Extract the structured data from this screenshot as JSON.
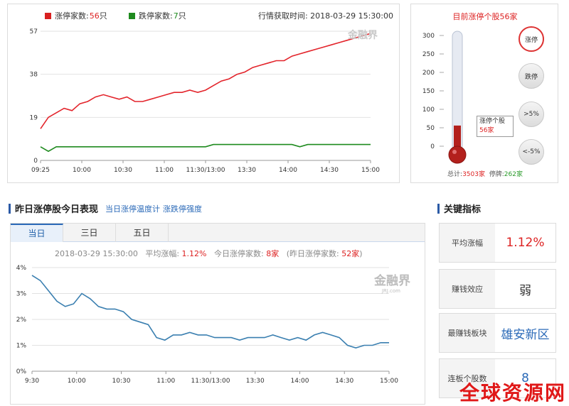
{
  "top": {
    "legend_up_label": "涨停家数:",
    "legend_up_value": "56",
    "legend_up_unit": "只",
    "legend_down_label": "跌停家数:",
    "legend_down_value": "7",
    "legend_down_unit": "只",
    "fetch_label": "行情获取时间:",
    "fetch_time": "2018-03-29 15:30:00",
    "watermark": "金融界",
    "chart_data": {
      "type": "line",
      "x_ticks": [
        "09:25",
        "10:00",
        "10:30",
        "11:00",
        "11:30/13:00",
        "13:30",
        "14:00",
        "14:30",
        "15:00"
      ],
      "y_ticks": [
        "57",
        "38",
        "19",
        "0"
      ],
      "ylim": [
        0,
        57
      ],
      "series": [
        {
          "name": "涨停家数",
          "color": "#e3242b",
          "values": [
            14,
            19,
            21,
            23,
            22,
            25,
            26,
            28,
            29,
            28,
            27,
            28,
            26,
            26,
            27,
            28,
            29,
            30,
            30,
            31,
            30,
            31,
            33,
            35,
            36,
            38,
            39,
            41,
            42,
            43,
            44,
            44,
            46,
            47,
            48,
            49,
            50,
            51,
            52,
            53,
            54,
            55,
            56
          ]
        },
        {
          "name": "跌停家数",
          "color": "#1e8a1e",
          "values": [
            6,
            4,
            6,
            6,
            6,
            6,
            6,
            6,
            6,
            6,
            6,
            6,
            6,
            6,
            6,
            6,
            6,
            6,
            6,
            6,
            6,
            6,
            7,
            7,
            7,
            7,
            7,
            7,
            7,
            7,
            7,
            7,
            7,
            6,
            7,
            7,
            7,
            7,
            7,
            7,
            7,
            7,
            7
          ]
        }
      ]
    }
  },
  "thermo": {
    "title": "目前涨停个股56家",
    "scale": [
      "300",
      "250",
      "200",
      "150",
      "100",
      "50",
      "0"
    ],
    "level_value": 56,
    "level_max": 300,
    "callout_label": "涨停个股",
    "callout_value": "56家",
    "buttons": [
      "涨停",
      "跌停",
      ">5%",
      "<-5%"
    ],
    "total_label": "总计:",
    "total_value": "3503家",
    "halt_label": "停牌:",
    "halt_value": "262家"
  },
  "section": {
    "title": "昨日涨停股今日表现",
    "link1": "当日涨停温度计",
    "link2": "涨跌停强度"
  },
  "bottom": {
    "tabs": [
      "当日",
      "三日",
      "五日"
    ],
    "info_time": "2018-03-29 15:30:00",
    "avg_label": "平均涨幅:",
    "avg_value": "1.12%",
    "today_label": "今日涨停家数:",
    "today_value": "8家",
    "yest_label": "(昨日涨停家数:",
    "yest_value": "52家",
    "yest_close": ")",
    "watermark": "金融界",
    "watermark_sub": "JRJ.com",
    "chart_data": {
      "type": "line",
      "x_ticks": [
        "9:30",
        "10:00",
        "10:30",
        "11:00",
        "11:30/13:00",
        "13:30",
        "14:00",
        "14:30",
        "15:00"
      ],
      "y_ticks": [
        "4%",
        "3%",
        "2%",
        "1%",
        "0%"
      ],
      "ylim": [
        0,
        4
      ],
      "series": [
        {
          "color": "#3a7fb0",
          "values": [
            3.7,
            3.5,
            3.1,
            2.7,
            2.5,
            2.6,
            3.0,
            2.8,
            2.5,
            2.4,
            2.4,
            2.3,
            2.0,
            1.9,
            1.8,
            1.3,
            1.2,
            1.4,
            1.4,
            1.5,
            1.4,
            1.4,
            1.3,
            1.3,
            1.3,
            1.2,
            1.3,
            1.3,
            1.3,
            1.4,
            1.3,
            1.2,
            1.3,
            1.2,
            1.4,
            1.5,
            1.4,
            1.3,
            1.0,
            0.9,
            1.0,
            1.0,
            1.1,
            1.1
          ]
        }
      ]
    }
  },
  "key": {
    "title": "关键指标",
    "cards": [
      {
        "label": "平均涨幅",
        "value": "1.12%",
        "color": "#d22"
      },
      {
        "label": "赚钱效应",
        "value": "弱",
        "color": "#333"
      },
      {
        "label": "最赚钱板块",
        "value": "雄安新区",
        "color": "#2b6ab8"
      },
      {
        "label": "连板个股数",
        "value": "8",
        "color": "#2b6ab8"
      }
    ]
  },
  "page_watermark": "全球资源网"
}
